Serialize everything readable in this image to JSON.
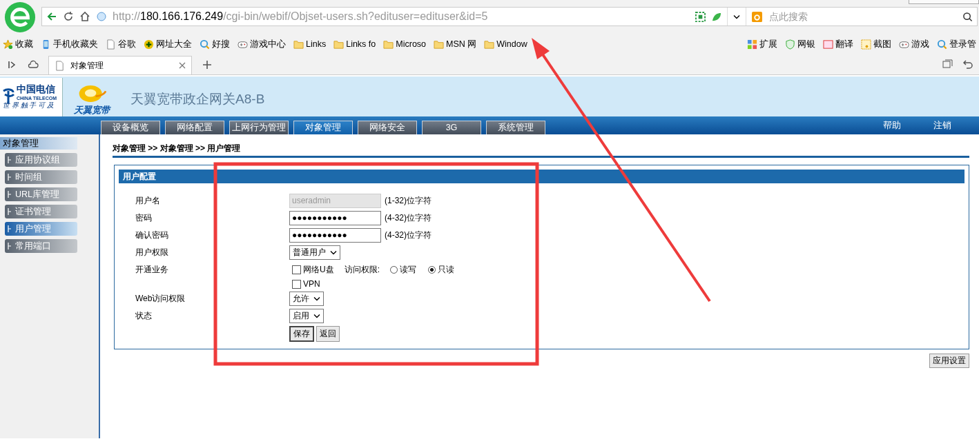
{
  "browser": {
    "address": {
      "scheme": "http://",
      "host": "180.166.176.249",
      "path": "/cgi-bin/webif/Objset-users.sh?edituser=edituser&id=5"
    },
    "search": {
      "placeholder": "点此搜索"
    },
    "bookmarks": [
      {
        "label": "收藏",
        "kind": "star"
      },
      {
        "label": "手机收藏夹",
        "kind": "phone"
      },
      {
        "label": "谷歌",
        "kind": "page"
      },
      {
        "label": "网址大全",
        "kind": "plus"
      },
      {
        "label": "好搜",
        "kind": "search"
      },
      {
        "label": "游戏中心",
        "kind": "gamepad"
      },
      {
        "label": "Links",
        "kind": "folder"
      },
      {
        "label": "Links fo",
        "kind": "folder"
      },
      {
        "label": "Microso",
        "kind": "folder"
      },
      {
        "label": "MSN 网",
        "kind": "folder"
      },
      {
        "label": "Window",
        "kind": "folder"
      }
    ],
    "tools": [
      {
        "label": "扩展",
        "kind": "grid"
      },
      {
        "label": "网银",
        "kind": "shield"
      },
      {
        "label": "翻译",
        "kind": "translate"
      },
      {
        "label": "截图",
        "kind": "scissors"
      },
      {
        "label": "游戏",
        "kind": "gamepad"
      },
      {
        "label": "登录管",
        "kind": "search"
      }
    ],
    "tabs": [
      {
        "label": "对象管理",
        "selected": true
      }
    ]
  },
  "header": {
    "brand": "中国电信",
    "brand_en": "CHINA TELECOM",
    "slogan": "世 界 触 手 可 及",
    "product": "天翼宽带",
    "title": "天翼宽带政企网关A8-B"
  },
  "nav": [
    {
      "label": "设备概览",
      "selected": false
    },
    {
      "label": "网络配置",
      "selected": false
    },
    {
      "label": "上网行为管理",
      "selected": false
    },
    {
      "label": "对象管理",
      "selected": true
    },
    {
      "label": "网络安全",
      "selected": false
    },
    {
      "label": "3G",
      "selected": false
    },
    {
      "label": "系统管理",
      "selected": false
    }
  ],
  "nav_links": [
    "帮助",
    "注销"
  ],
  "sidebar": {
    "title": "对象管理",
    "items": [
      {
        "label": "应用协议组",
        "selected": false
      },
      {
        "label": "时间组",
        "selected": false
      },
      {
        "label": "URL库管理",
        "selected": false
      },
      {
        "label": "证书管理",
        "selected": false
      },
      {
        "label": "用户管理",
        "selected": true
      },
      {
        "label": "常用端口",
        "selected": false
      }
    ]
  },
  "breadcrumb": "对象管理 >> 对象管理 >> 用户管理",
  "panel": {
    "title": "用户配置",
    "rows": [
      {
        "kind": "text",
        "label": "用户名",
        "value": "useradmin",
        "disabled": true,
        "hint": "(1-32)位字符"
      },
      {
        "kind": "text",
        "label": "密码",
        "value": "●●●●●●●●●●●",
        "disabled": false,
        "hint": "(4-32)位字符"
      },
      {
        "kind": "text",
        "label": "确认密码",
        "value": "●●●●●●●●●●●",
        "disabled": false,
        "hint": "(4-32)位字符"
      },
      {
        "kind": "select",
        "label": "用户权限",
        "value": "普通用户"
      },
      {
        "kind": "services",
        "label": "开通业务",
        "options": [
          {
            "label": "网络U盘",
            "checked": false
          },
          {
            "label": "VPN",
            "checked": false
          }
        ],
        "access_label": "访问权限:",
        "access": [
          {
            "label": "读写",
            "selected": false
          },
          {
            "label": "只读",
            "selected": true
          }
        ]
      },
      {
        "kind": "select",
        "label": "Web访问权限",
        "value": "允许"
      },
      {
        "kind": "select",
        "label": "状态",
        "value": "启用"
      }
    ],
    "buttons": [
      "保存",
      "返回"
    ]
  },
  "apply_button": "应用设置"
}
